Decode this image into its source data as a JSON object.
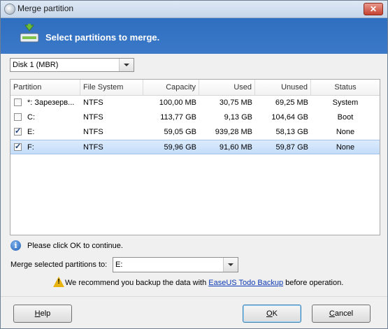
{
  "window": {
    "title": "Merge partition",
    "close_glyph": "✕"
  },
  "banner": {
    "title": "Select partitions to merge.",
    "icon": "merge-partition-icon"
  },
  "disk_select": {
    "value": "Disk 1 (MBR)"
  },
  "table": {
    "columns": [
      "Partition",
      "File System",
      "Capacity",
      "Used",
      "Unused",
      "Status"
    ],
    "rows": [
      {
        "checked": false,
        "selected": false,
        "partition": "*: Зарезерв...",
        "fs": "NTFS",
        "capacity": "100,00 MB",
        "used": "30,75 MB",
        "unused": "69,25 MB",
        "status": "System"
      },
      {
        "checked": false,
        "selected": false,
        "partition": "C:",
        "fs": "NTFS",
        "capacity": "113,77 GB",
        "used": "9,13 GB",
        "unused": "104,64 GB",
        "status": "Boot"
      },
      {
        "checked": true,
        "selected": false,
        "partition": "E:",
        "fs": "NTFS",
        "capacity": "59,05 GB",
        "used": "939,28 MB",
        "unused": "58,13 GB",
        "status": "None"
      },
      {
        "checked": true,
        "selected": true,
        "partition": "F:",
        "fs": "NTFS",
        "capacity": "59,96 GB",
        "used": "91,60 MB",
        "unused": "59,87 GB",
        "status": "None"
      }
    ]
  },
  "info": {
    "text": "Please click OK to continue."
  },
  "merge_to": {
    "label": "Merge selected partitions to:",
    "value": "E:"
  },
  "warning": {
    "prefix": "We recommend you backup the data with ",
    "link": "EaseUS Todo Backup",
    "suffix": " before operation."
  },
  "buttons": {
    "help": {
      "mnemonic": "H",
      "rest": "elp"
    },
    "ok": {
      "mnemonic": "O",
      "rest": "K"
    },
    "cancel": {
      "mnemonic": "C",
      "rest": "ancel"
    }
  },
  "colors": {
    "banner": "#3b78c8",
    "selection": "#c4ddfa",
    "link": "#0b39b3"
  }
}
